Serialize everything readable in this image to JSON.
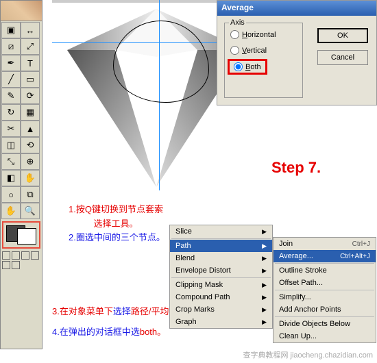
{
  "dialog": {
    "title": "Average",
    "axis_label": "Axis",
    "horizontal": "Horizontal",
    "vertical": "Vertical",
    "both": "Both",
    "ok": "OK",
    "cancel": "Cancel"
  },
  "step": "Step 7.",
  "instructions": {
    "l1a": "1.按Q键切换到节点套索",
    "l1b": "选择工具。",
    "l2": "2.圈选中间的三个节点。",
    "l3_pre": "3.在对象菜单下",
    "l3_blue": "选择",
    "l3_post": "路径/平均分配。",
    "l4_pre": "4.在弹出的对话框中选",
    "l4_red": "both。"
  },
  "menu1": {
    "slice": "Slice",
    "path": "Path",
    "blend": "Blend",
    "envelope": "Envelope Distort",
    "clipping": "Clipping Mask",
    "compound": "Compound Path",
    "crop": "Crop Marks",
    "graph": "Graph"
  },
  "menu2": {
    "join": "Join",
    "join_sc": "Ctrl+J",
    "average": "Average...",
    "average_sc": "Ctrl+Alt+J",
    "outline": "Outline Stroke",
    "offset": "Offset Path...",
    "simplify": "Simplify...",
    "addanchor": "Add Anchor Points",
    "divide": "Divide Objects Below",
    "cleanup": "Clean Up..."
  },
  "tools": [
    "▣",
    "↔",
    "⧄",
    "⤢",
    "✒",
    "T",
    "╱",
    "▭",
    "✎",
    "⟳",
    "↻",
    "▦",
    "✂",
    "▲",
    "◫",
    "⟲",
    "⤡",
    "⊕",
    "◧",
    "✋",
    "○",
    "⧉"
  ],
  "watermark": "查字典教程网 jiaocheng.chazidian.com"
}
